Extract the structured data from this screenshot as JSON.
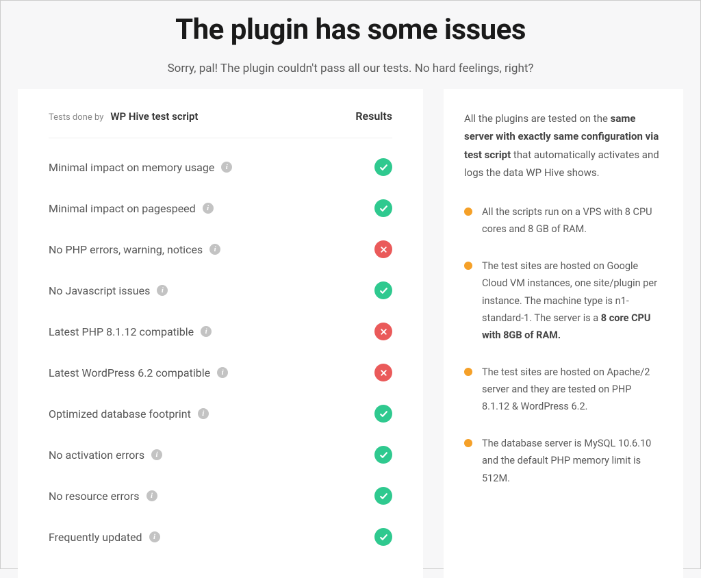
{
  "header": {
    "title": "The plugin has some issues",
    "subtitle": "Sorry, pal! The plugin couldn't pass all our tests. No hard feelings, right?"
  },
  "tests": {
    "done_by_label": "Tests done by",
    "script_name": "WP Hive test script",
    "results_label": "Results",
    "items": [
      {
        "label": "Minimal impact on memory usage",
        "pass": true
      },
      {
        "label": "Minimal impact on pagespeed",
        "pass": true
      },
      {
        "label": "No PHP errors, warning, notices",
        "pass": false
      },
      {
        "label": "No Javascript issues",
        "pass": true
      },
      {
        "label": "Latest PHP 8.1.12 compatible",
        "pass": false
      },
      {
        "label": "Latest WordPress 6.2 compatible",
        "pass": false
      },
      {
        "label": "Optimized database footprint",
        "pass": true
      },
      {
        "label": "No activation errors",
        "pass": true
      },
      {
        "label": "No resource errors",
        "pass": true
      },
      {
        "label": "Frequently updated",
        "pass": true
      }
    ]
  },
  "info": {
    "intro_pre": "All the plugins are tested on the ",
    "intro_bold": "same server with exactly same configuration via test script",
    "intro_post": " that automatically activates and logs the data WP Hive shows.",
    "items": [
      {
        "pre": "All the scripts run on a VPS with 8 CPU cores and 8 GB of RAM.",
        "bold": "",
        "post": ""
      },
      {
        "pre": "The test sites are hosted on Google Cloud VM instances, one site/plugin per instance. The machine type is n1-standard-1. The server is a ",
        "bold": "8 core CPU with 8GB of RAM.",
        "post": ""
      },
      {
        "pre": "The test sites are hosted on Apache/2 server and they are tested on PHP 8.1.12 & WordPress 6.2.",
        "bold": "",
        "post": ""
      },
      {
        "pre": "The database server is MySQL 10.6.10 and the default PHP memory limit is 512M.",
        "bold": "",
        "post": ""
      }
    ]
  }
}
